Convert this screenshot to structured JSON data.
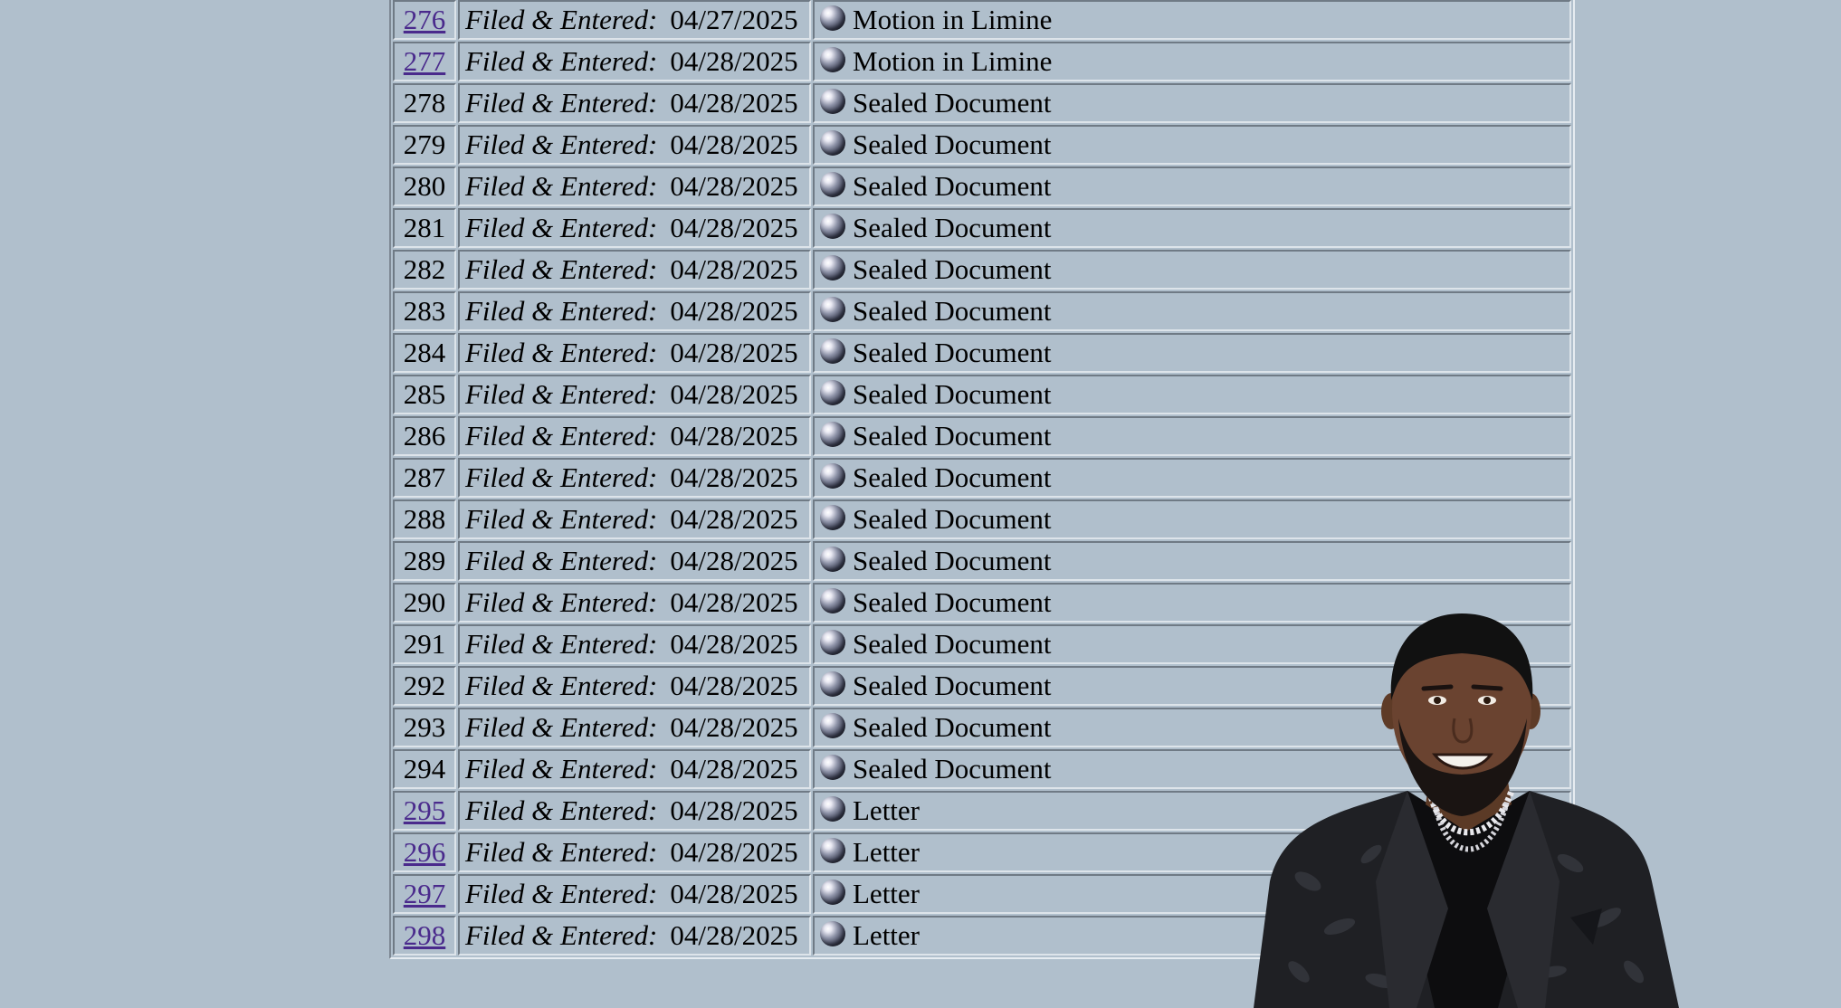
{
  "filed_label": "Filed & Entered:",
  "entries": [
    {
      "number": "276",
      "linked": true,
      "date": "04/27/2025",
      "description": "Motion in Limine"
    },
    {
      "number": "277",
      "linked": true,
      "date": "04/28/2025",
      "description": "Motion in Limine"
    },
    {
      "number": "278",
      "linked": false,
      "date": "04/28/2025",
      "description": "Sealed Document"
    },
    {
      "number": "279",
      "linked": false,
      "date": "04/28/2025",
      "description": "Sealed Document"
    },
    {
      "number": "280",
      "linked": false,
      "date": "04/28/2025",
      "description": "Sealed Document"
    },
    {
      "number": "281",
      "linked": false,
      "date": "04/28/2025",
      "description": "Sealed Document"
    },
    {
      "number": "282",
      "linked": false,
      "date": "04/28/2025",
      "description": "Sealed Document"
    },
    {
      "number": "283",
      "linked": false,
      "date": "04/28/2025",
      "description": "Sealed Document"
    },
    {
      "number": "284",
      "linked": false,
      "date": "04/28/2025",
      "description": "Sealed Document"
    },
    {
      "number": "285",
      "linked": false,
      "date": "04/28/2025",
      "description": "Sealed Document"
    },
    {
      "number": "286",
      "linked": false,
      "date": "04/28/2025",
      "description": "Sealed Document"
    },
    {
      "number": "287",
      "linked": false,
      "date": "04/28/2025",
      "description": "Sealed Document"
    },
    {
      "number": "288",
      "linked": false,
      "date": "04/28/2025",
      "description": "Sealed Document"
    },
    {
      "number": "289",
      "linked": false,
      "date": "04/28/2025",
      "description": "Sealed Document"
    },
    {
      "number": "290",
      "linked": false,
      "date": "04/28/2025",
      "description": "Sealed Document"
    },
    {
      "number": "291",
      "linked": false,
      "date": "04/28/2025",
      "description": "Sealed Document"
    },
    {
      "number": "292",
      "linked": false,
      "date": "04/28/2025",
      "description": "Sealed Document"
    },
    {
      "number": "293",
      "linked": false,
      "date": "04/28/2025",
      "description": "Sealed Document"
    },
    {
      "number": "294",
      "linked": false,
      "date": "04/28/2025",
      "description": "Sealed Document"
    },
    {
      "number": "295",
      "linked": true,
      "date": "04/28/2025",
      "description": "Letter"
    },
    {
      "number": "296",
      "linked": true,
      "date": "04/28/2025",
      "description": "Letter"
    },
    {
      "number": "297",
      "linked": true,
      "date": "04/28/2025",
      "description": "Letter"
    },
    {
      "number": "298",
      "linked": true,
      "date": "04/28/2025",
      "description": "Letter"
    }
  ],
  "colors": {
    "background": "#b0bfcc",
    "link": "#4a2a8c"
  },
  "icons": {
    "entry_icon": "globe-icon"
  }
}
